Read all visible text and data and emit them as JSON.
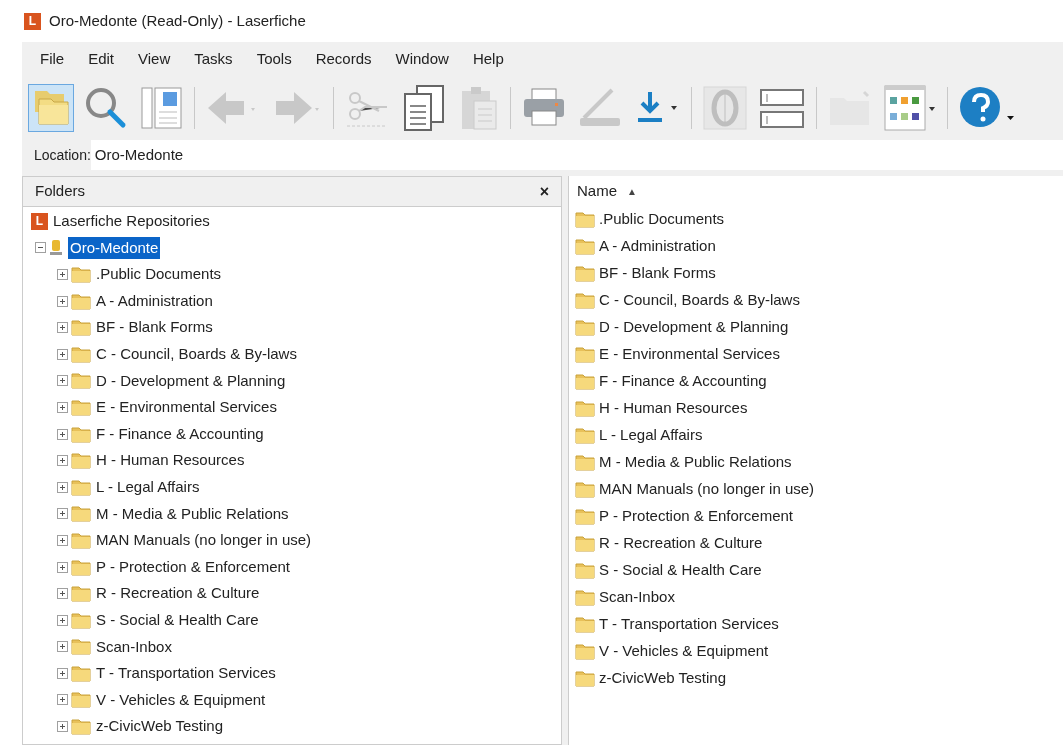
{
  "window": {
    "logo": "L",
    "title": "Oro-Medonte (Read-Only) - Laserfiche"
  },
  "menu": [
    "File",
    "Edit",
    "View",
    "Tasks",
    "Tools",
    "Records",
    "Window",
    "Help"
  ],
  "toolbar": [
    {
      "kind": "folders",
      "selected": true,
      "disabled": false
    },
    {
      "kind": "search",
      "selected": false,
      "disabled": false
    },
    {
      "kind": "preview",
      "selected": false,
      "disabled": false
    },
    {
      "kind": "sep"
    },
    {
      "kind": "back",
      "selected": false,
      "disabled": true
    },
    {
      "kind": "forward",
      "selected": false,
      "disabled": true
    },
    {
      "kind": "sep"
    },
    {
      "kind": "cut",
      "selected": false,
      "disabled": true
    },
    {
      "kind": "copy",
      "selected": false,
      "disabled": false
    },
    {
      "kind": "paste",
      "selected": false,
      "disabled": true
    },
    {
      "kind": "sep"
    },
    {
      "kind": "print",
      "selected": false,
      "disabled": false
    },
    {
      "kind": "scan",
      "selected": false,
      "disabled": true
    },
    {
      "kind": "download",
      "selected": false,
      "disabled": false
    },
    {
      "kind": "sep"
    },
    {
      "kind": "ocr",
      "selected": false,
      "disabled": true
    },
    {
      "kind": "fields",
      "selected": false,
      "disabled": false
    },
    {
      "kind": "sep"
    },
    {
      "kind": "newfolder",
      "selected": false,
      "disabled": true
    },
    {
      "kind": "views",
      "selected": false,
      "disabled": false
    },
    {
      "kind": "sep"
    },
    {
      "kind": "help",
      "selected": false,
      "disabled": false
    }
  ],
  "location": {
    "label": "Location:",
    "value": "Oro-Medonte"
  },
  "folders_pane": {
    "title": "Folders",
    "close": "×",
    "tree": [
      {
        "logo": "L",
        "label": "Laserfiche Repositories",
        "kind": "root",
        "selected": false,
        "children": [
          {
            "label": "Oro-Medonte",
            "kind": "repository",
            "expanded": true,
            "selected": true,
            "children": [
              {
                "label": ".Public Documents",
                "kind": "folder",
                "expanded": false,
                "selected": false
              },
              {
                "label": "A - Administration",
                "kind": "folder",
                "expanded": false,
                "selected": false
              },
              {
                "label": "BF - Blank Forms",
                "kind": "folder",
                "expanded": false,
                "selected": false
              },
              {
                "label": "C - Council, Boards & By-laws",
                "kind": "folder",
                "expanded": false,
                "selected": false
              },
              {
                "label": "D - Development & Planning",
                "kind": "folder",
                "expanded": false,
                "selected": false
              },
              {
                "label": "E - Environmental Services",
                "kind": "folder",
                "expanded": false,
                "selected": false
              },
              {
                "label": "F - Finance & Accounting",
                "kind": "folder",
                "expanded": false,
                "selected": false
              },
              {
                "label": "H - Human Resources",
                "kind": "folder",
                "expanded": false,
                "selected": false
              },
              {
                "label": "L - Legal Affairs",
                "kind": "folder",
                "expanded": false,
                "selected": false
              },
              {
                "label": "M - Media & Public Relations",
                "kind": "folder",
                "expanded": false,
                "selected": false
              },
              {
                "label": "MAN Manuals (no longer in use)",
                "kind": "folder",
                "expanded": false,
                "selected": false
              },
              {
                "label": "P - Protection & Enforcement",
                "kind": "folder",
                "expanded": false,
                "selected": false
              },
              {
                "label": "R - Recreation & Culture",
                "kind": "folder",
                "expanded": false,
                "selected": false
              },
              {
                "label": "S - Social & Health Care",
                "kind": "folder",
                "expanded": false,
                "selected": false
              },
              {
                "label": "Scan-Inbox",
                "kind": "folder",
                "expanded": false,
                "selected": false
              },
              {
                "label": "T - Transportation Services",
                "kind": "folder",
                "expanded": false,
                "selected": false
              },
              {
                "label": "V - Vehicles & Equipment",
                "kind": "folder",
                "expanded": false,
                "selected": false
              },
              {
                "label": "z-CivicWeb Testing",
                "kind": "folder",
                "expanded": false,
                "selected": false
              }
            ]
          }
        ]
      }
    ]
  },
  "list_pane": {
    "column": "Name",
    "sort": "▲",
    "items": [
      ".Public Documents",
      "A - Administration",
      "BF - Blank Forms",
      "C - Council, Boards & By-laws",
      "D - Development & Planning",
      "E - Environmental Services",
      "F - Finance & Accounting",
      "H - Human Resources",
      "L - Legal Affairs",
      "M - Media & Public Relations",
      "MAN Manuals (no longer in use)",
      "P - Protection & Enforcement",
      "R - Recreation & Culture",
      "S - Social & Health Care",
      "Scan-Inbox",
      "T - Transportation Services",
      "V - Vehicles & Equipment",
      "z-CivicWeb Testing"
    ]
  }
}
